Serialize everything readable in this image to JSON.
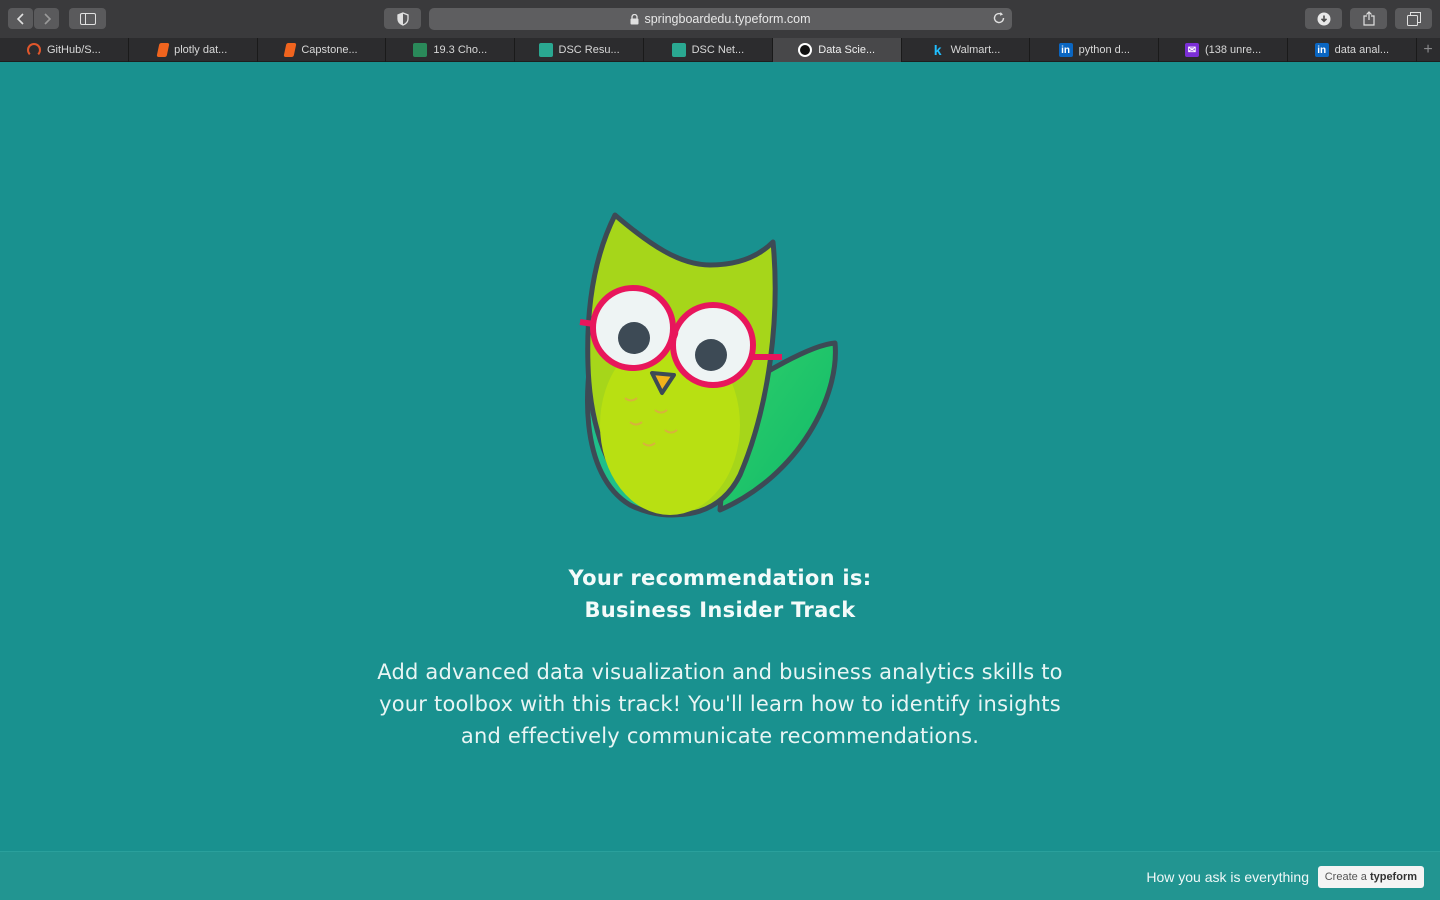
{
  "browser": {
    "url": "springboardedu.typeform.com",
    "tabs": [
      {
        "label": "GitHub/S...",
        "icon": "github-icon",
        "color": "#e0562b"
      },
      {
        "label": "plotly dat...",
        "icon": "book-icon",
        "color": "#f0641e"
      },
      {
        "label": "Capstone...",
        "icon": "book-icon",
        "color": "#f0641e"
      },
      {
        "label": "19.3 Cho...",
        "icon": "springboard-icon",
        "color": "#2a8a5a"
      },
      {
        "label": "DSC Resu...",
        "icon": "dsc-icon",
        "color": "#2aa891"
      },
      {
        "label": "DSC Net...",
        "icon": "dsc-icon",
        "color": "#2aa891"
      },
      {
        "label": "Data Scie...",
        "icon": "typeform-icon",
        "color": "#ffffff",
        "active": true
      },
      {
        "label": "Walmart...",
        "icon": "kaggle-icon",
        "color": "#20beff"
      },
      {
        "label": "python d...",
        "icon": "linkedin-icon",
        "color": "#0a66c2"
      },
      {
        "label": "(138 unre...",
        "icon": "mail-icon",
        "color": "#7b2fd6"
      },
      {
        "label": "data anal...",
        "icon": "linkedin-icon",
        "color": "#0a66c2"
      }
    ]
  },
  "content": {
    "recommendation_heading": "Your recommendation is:",
    "track_name": "Business Insider Track",
    "description_lines": [
      "Add advanced data visualization and business analytics skills to",
      "your toolbox with this track! You'll learn how to identify insights",
      "and effectively communicate recommendations."
    ]
  },
  "footer": {
    "tagline": "How you ask is everything",
    "create_prefix": "Create a",
    "create_brand": "typeform"
  },
  "colors": {
    "background": "#19918f",
    "owl_green": "#a6d61a",
    "glasses": "#e8165c"
  }
}
